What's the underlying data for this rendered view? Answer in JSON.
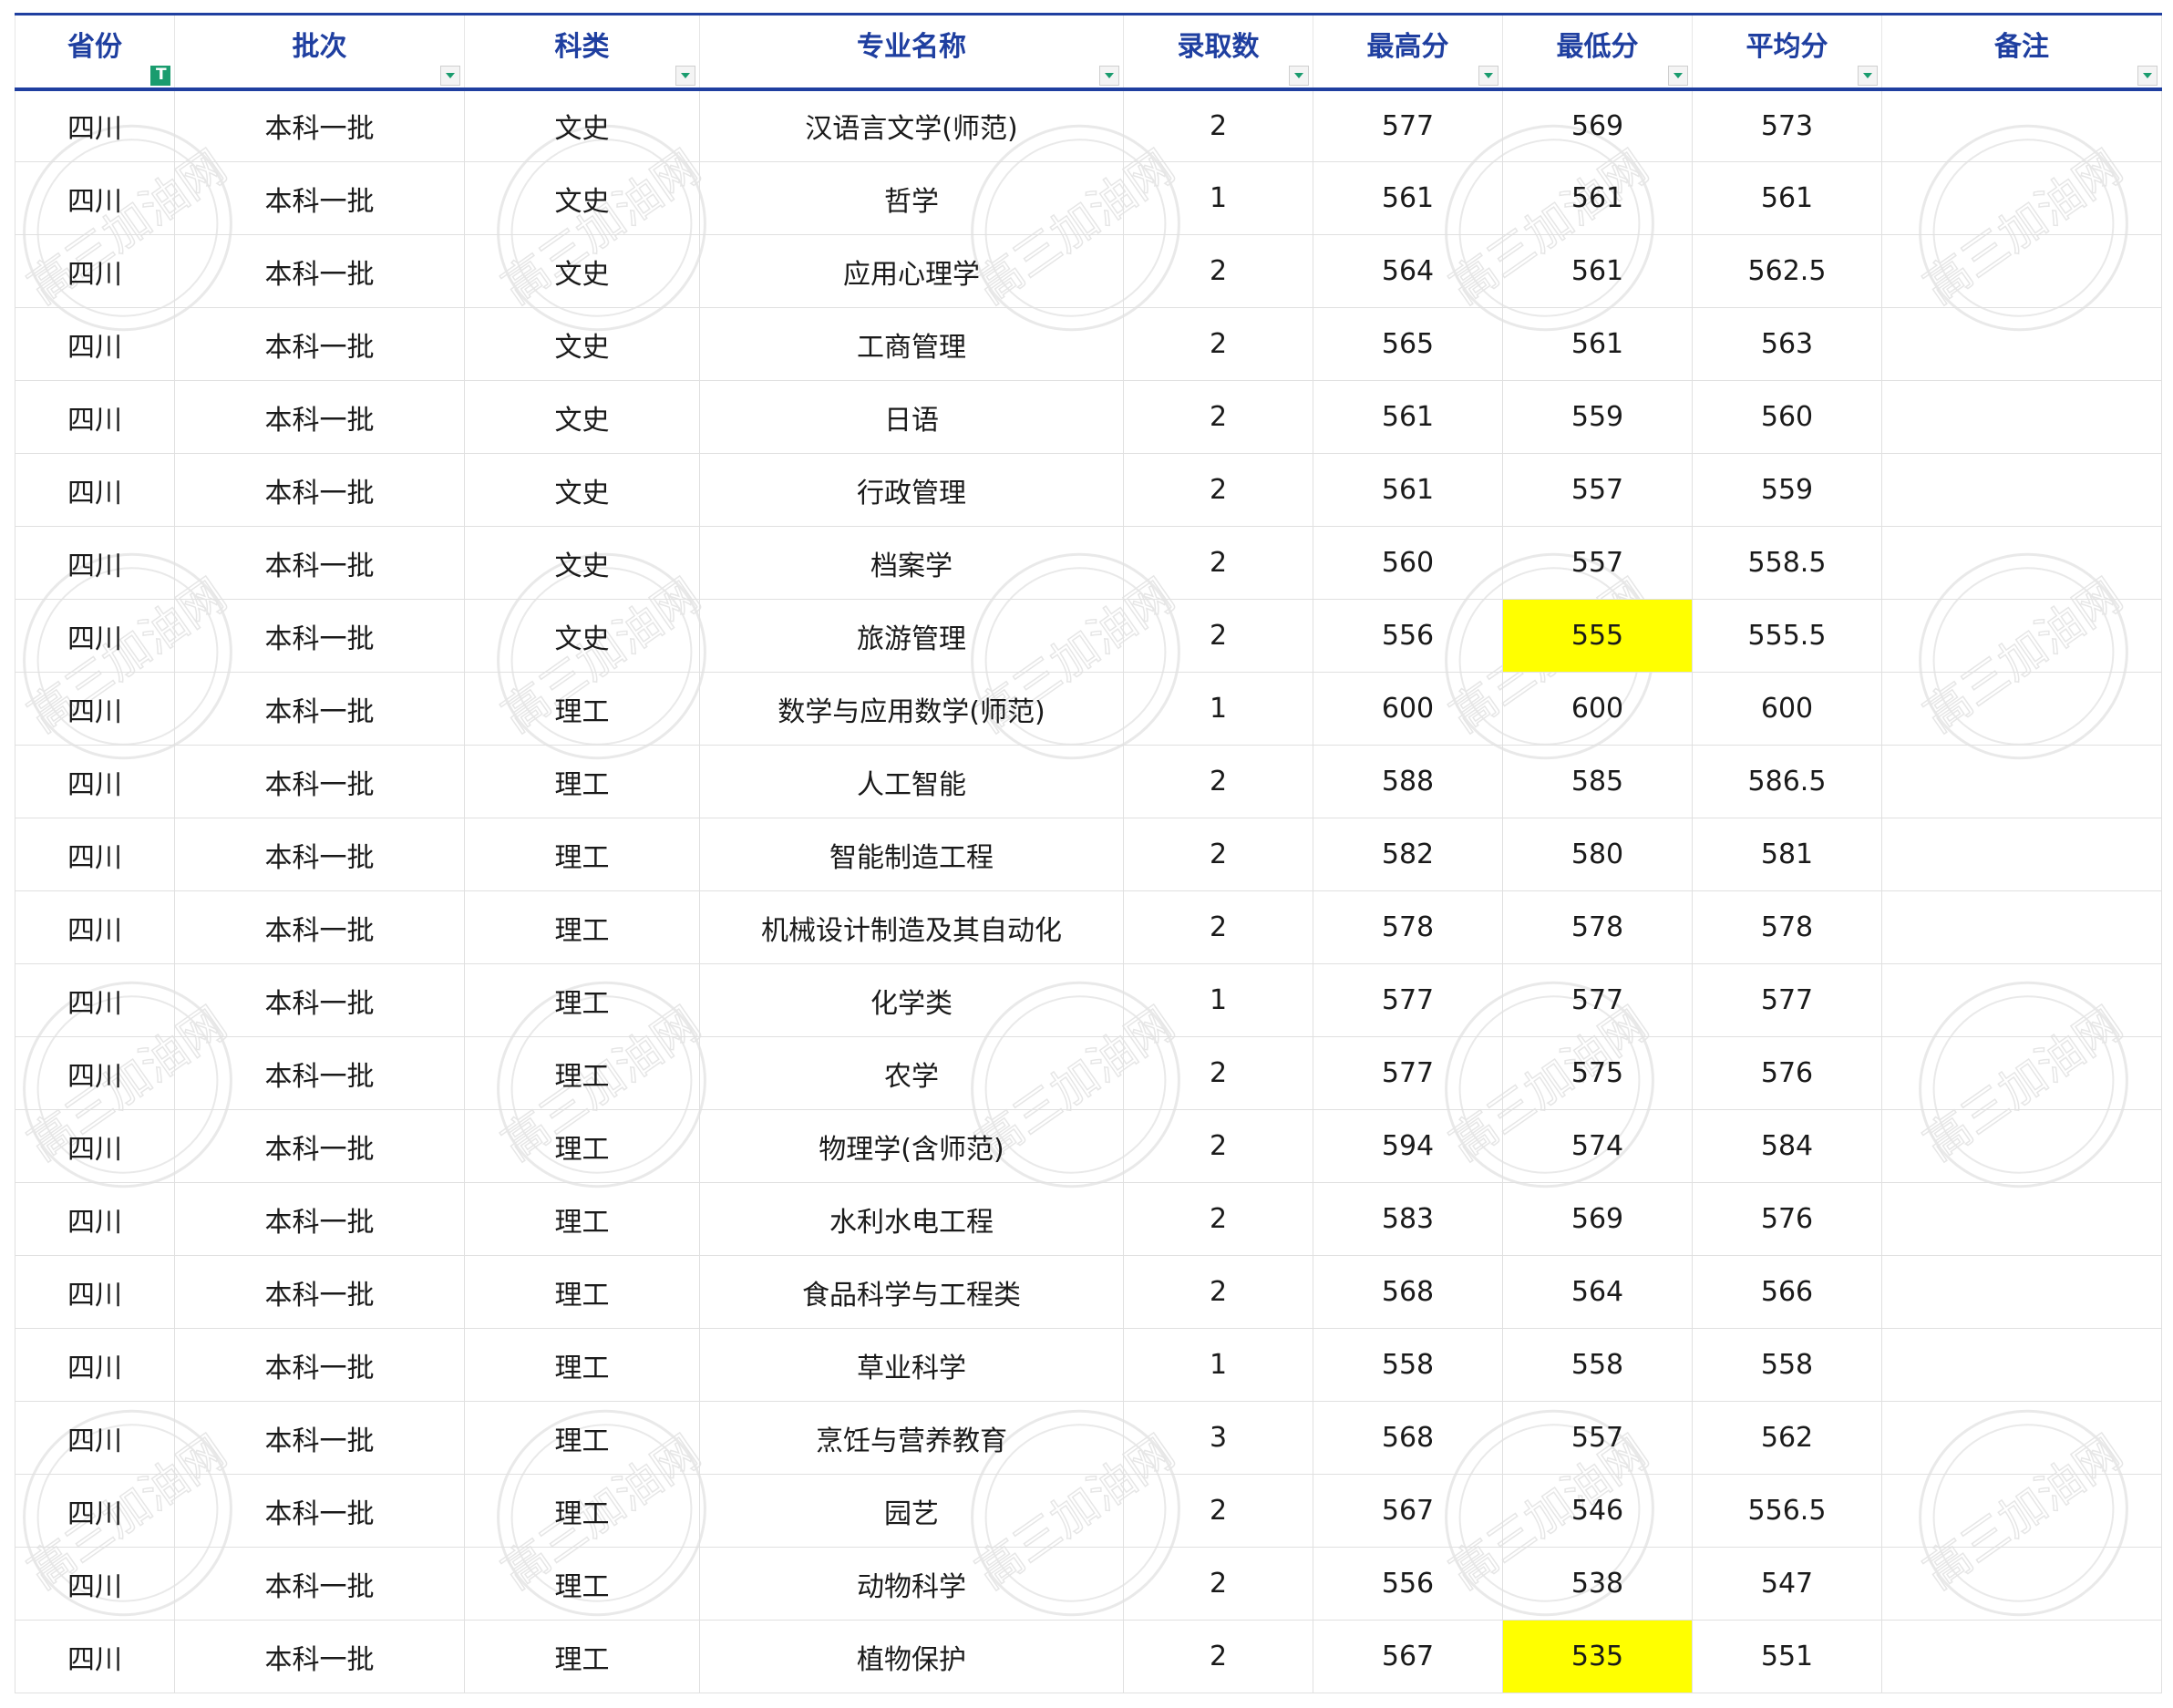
{
  "columns": [
    {
      "key": "province",
      "label": "省份"
    },
    {
      "key": "batch",
      "label": "批次"
    },
    {
      "key": "category",
      "label": "科类"
    },
    {
      "key": "major",
      "label": "专业名称"
    },
    {
      "key": "admitted",
      "label": "录取数"
    },
    {
      "key": "max",
      "label": "最高分"
    },
    {
      "key": "min",
      "label": "最低分"
    },
    {
      "key": "avg",
      "label": "平均分"
    },
    {
      "key": "note",
      "label": "备注"
    }
  ],
  "rows": [
    [
      "四川",
      "本科一批",
      "文史",
      "汉语言文学(师范)",
      "2",
      "577",
      "569",
      "573",
      ""
    ],
    [
      "四川",
      "本科一批",
      "文史",
      "哲学",
      "1",
      "561",
      "561",
      "561",
      ""
    ],
    [
      "四川",
      "本科一批",
      "文史",
      "应用心理学",
      "2",
      "564",
      "561",
      "562.5",
      ""
    ],
    [
      "四川",
      "本科一批",
      "文史",
      "工商管理",
      "2",
      "565",
      "561",
      "563",
      ""
    ],
    [
      "四川",
      "本科一批",
      "文史",
      "日语",
      "2",
      "561",
      "559",
      "560",
      ""
    ],
    [
      "四川",
      "本科一批",
      "文史",
      "行政管理",
      "2",
      "561",
      "557",
      "559",
      ""
    ],
    [
      "四川",
      "本科一批",
      "文史",
      "档案学",
      "2",
      "560",
      "557",
      "558.5",
      ""
    ],
    [
      "四川",
      "本科一批",
      "文史",
      "旅游管理",
      "2",
      "556",
      "555",
      "555.5",
      ""
    ],
    [
      "四川",
      "本科一批",
      "理工",
      "数学与应用数学(师范)",
      "1",
      "600",
      "600",
      "600",
      ""
    ],
    [
      "四川",
      "本科一批",
      "理工",
      "人工智能",
      "2",
      "588",
      "585",
      "586.5",
      ""
    ],
    [
      "四川",
      "本科一批",
      "理工",
      "智能制造工程",
      "2",
      "582",
      "580",
      "581",
      ""
    ],
    [
      "四川",
      "本科一批",
      "理工",
      "机械设计制造及其自动化",
      "2",
      "578",
      "578",
      "578",
      ""
    ],
    [
      "四川",
      "本科一批",
      "理工",
      "化学类",
      "1",
      "577",
      "577",
      "577",
      ""
    ],
    [
      "四川",
      "本科一批",
      "理工",
      "农学",
      "2",
      "577",
      "575",
      "576",
      ""
    ],
    [
      "四川",
      "本科一批",
      "理工",
      "物理学(含师范)",
      "2",
      "594",
      "574",
      "584",
      ""
    ],
    [
      "四川",
      "本科一批",
      "理工",
      "水利水电工程",
      "2",
      "583",
      "569",
      "576",
      ""
    ],
    [
      "四川",
      "本科一批",
      "理工",
      "食品科学与工程类",
      "2",
      "568",
      "564",
      "566",
      ""
    ],
    [
      "四川",
      "本科一批",
      "理工",
      "草业科学",
      "1",
      "558",
      "558",
      "558",
      ""
    ],
    [
      "四川",
      "本科一批",
      "理工",
      "烹饪与营养教育",
      "3",
      "568",
      "557",
      "562",
      ""
    ],
    [
      "四川",
      "本科一批",
      "理工",
      "园艺",
      "2",
      "567",
      "546",
      "556.5",
      ""
    ],
    [
      "四川",
      "本科一批",
      "理工",
      "动物科学",
      "2",
      "556",
      "538",
      "547",
      ""
    ],
    [
      "四川",
      "本科一批",
      "理工",
      "植物保护",
      "2",
      "567",
      "535",
      "551",
      ""
    ]
  ],
  "highlighted_cells": [
    {
      "row": 7,
      "col": 6
    },
    {
      "row": 21,
      "col": 6
    }
  ],
  "active_filter_column": 0,
  "colors": {
    "header_text": "#1f3fa0",
    "highlight": "#ffff00",
    "filter_active": "#1a9c6e"
  },
  "watermark": {
    "text": "高三加油网"
  }
}
